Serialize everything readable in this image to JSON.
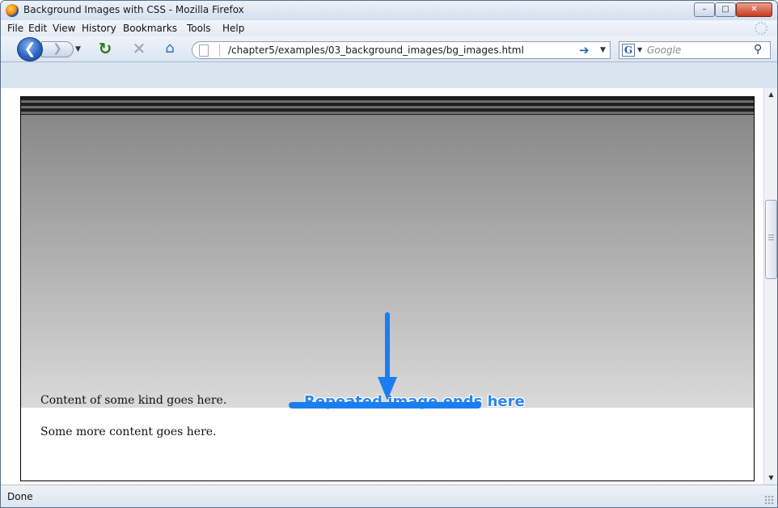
{
  "window": {
    "title": "Background Images with CSS - Mozilla Firefox",
    "controls": {
      "minimize": "–",
      "maximize": "□",
      "close": "✕"
    }
  },
  "menubar": {
    "items": [
      {
        "label": "File"
      },
      {
        "label": "Edit"
      },
      {
        "label": "View"
      },
      {
        "label": "History"
      },
      {
        "label": "Bookmarks"
      },
      {
        "label": "Tools"
      },
      {
        "label": "Help"
      }
    ]
  },
  "toolbar": {
    "back_glyph": "❮",
    "forward_glyph": "❯",
    "dropdown_glyph": "▼",
    "reload_glyph": "↻",
    "stop_glyph": "✕",
    "home_glyph": "⌂",
    "go_glyph": "➔",
    "search_glyph": "⚲",
    "icons": [
      "back-icon",
      "forward-icon",
      "reload-icon",
      "stop-icon",
      "home-icon",
      "go-icon",
      "magnifier-icon"
    ]
  },
  "address": {
    "url": "/chapter5/examples/03_background_images/bg_images.html"
  },
  "search": {
    "engine_letter": "G",
    "placeholder": "Google"
  },
  "page": {
    "paragraph_1": "Content of some kind goes here.",
    "paragraph_2": "Some more content goes here.",
    "annotation": "Repeated image ends here"
  },
  "colors": {
    "annotation": "#1a7ef0",
    "stripe_dark": "#1f1f1f",
    "gradient_top": "#888888",
    "gradient_bottom": "#dadada"
  },
  "scrollbar": {
    "up_glyph": "▲",
    "down_glyph": "▼"
  },
  "status": {
    "text": "Done"
  }
}
